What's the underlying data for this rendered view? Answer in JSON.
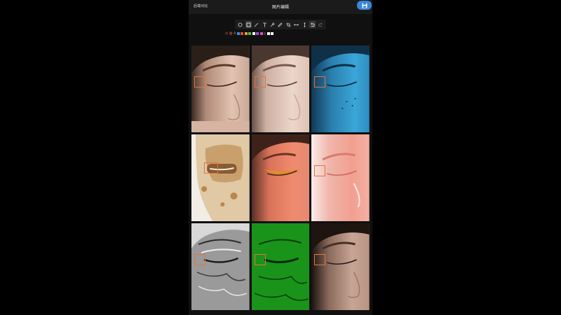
{
  "header": {
    "left_label": "后端对比",
    "title": "图片编辑",
    "save_icon": "save-icon"
  },
  "toolbar": {
    "tools": [
      "circle",
      "rectangle",
      "line",
      "text",
      "pin",
      "pen",
      "crop",
      "horizontal-resize",
      "vertical-resize",
      "undo",
      "redo"
    ],
    "active_tool": "rectangle"
  },
  "palette": {
    "glyphs": [
      "⊙",
      "▥",
      "A"
    ],
    "colors": [
      "#3b8cf0",
      "#e04f3f",
      "#f0a030",
      "#50c050",
      "#ffffff",
      "#9050e0",
      "#e04fb0",
      "#333333",
      "#ffffff",
      "#ffffff"
    ]
  },
  "images": [
    {
      "label": "",
      "tone": "natural"
    },
    {
      "label": "",
      "tone": "natural-light"
    },
    {
      "label": "",
      "tone": "blue-uv"
    },
    {
      "label": "",
      "tone": "brown-spots"
    },
    {
      "label": "",
      "tone": "red-area"
    },
    {
      "label": "",
      "tone": "red-vascular"
    },
    {
      "label": "",
      "tone": "texture-gray"
    },
    {
      "label": "",
      "tone": "green-pores"
    },
    {
      "label": "",
      "tone": "natural-dark"
    }
  ],
  "colors": {
    "accent": "#3a86d7",
    "roi": "#e3753f",
    "background": "#000000"
  }
}
